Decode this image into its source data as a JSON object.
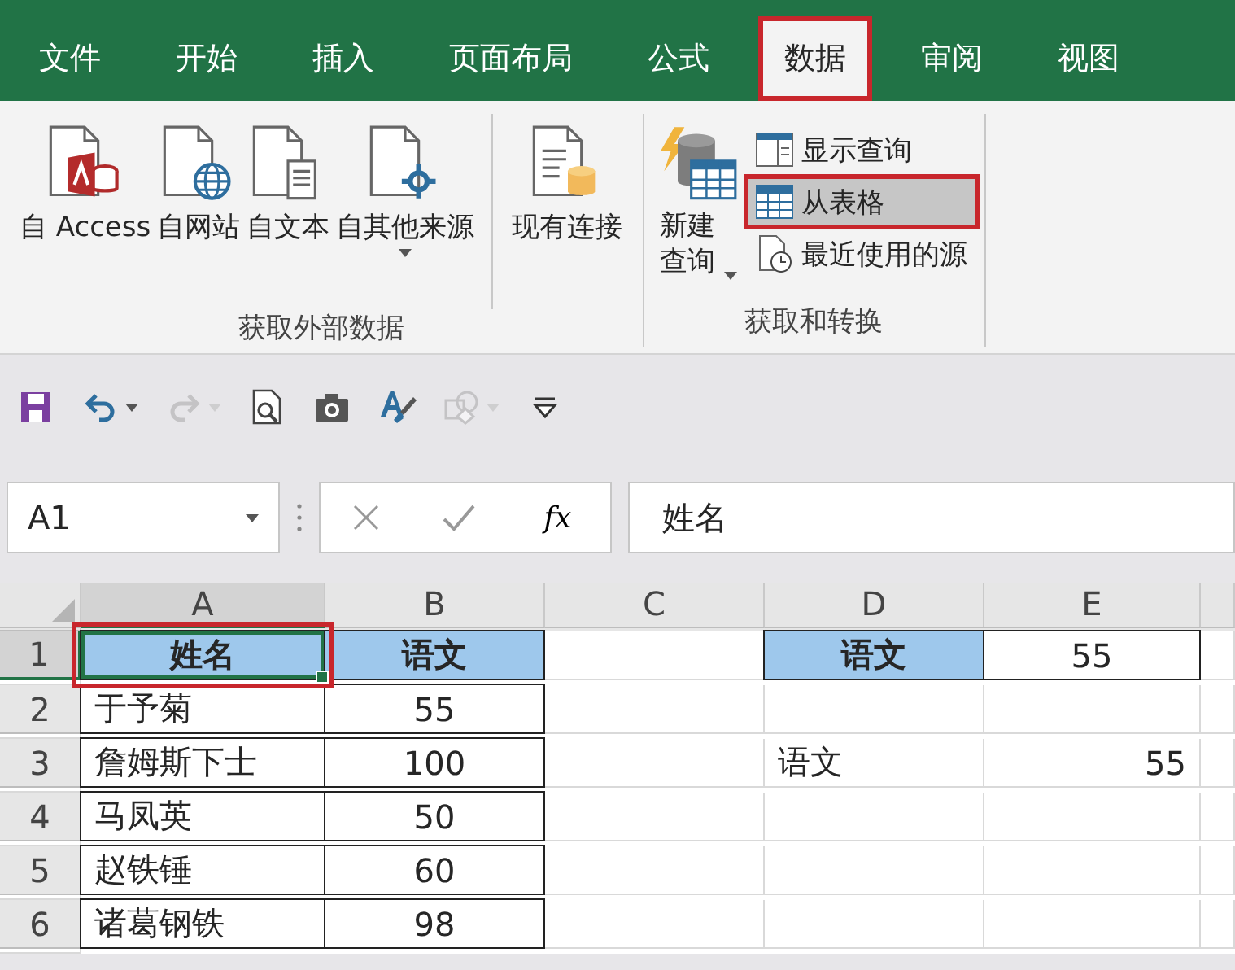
{
  "tabs": [
    {
      "label": "文件",
      "selected": false,
      "highlighted": false
    },
    {
      "label": "开始",
      "selected": false,
      "highlighted": false
    },
    {
      "label": "插入",
      "selected": false,
      "highlighted": false
    },
    {
      "label": "页面布局",
      "selected": false,
      "highlighted": false
    },
    {
      "label": "公式",
      "selected": false,
      "highlighted": false
    },
    {
      "label": "数据",
      "selected": true,
      "highlighted": true
    },
    {
      "label": "审阅",
      "selected": false,
      "highlighted": false
    },
    {
      "label": "视图",
      "selected": false,
      "highlighted": false
    }
  ],
  "ribbon": {
    "groups": [
      {
        "label": "获取外部数据",
        "sections": [
          [
            {
              "kind": "access",
              "label": "自 Access",
              "dropdown": false
            },
            {
              "kind": "web",
              "label": "自网站",
              "dropdown": false
            },
            {
              "kind": "text",
              "label": "自文本",
              "dropdown": false
            },
            {
              "kind": "other",
              "label": "自其他来源",
              "dropdown": true
            }
          ],
          [
            {
              "kind": "connection",
              "label": "现有连接",
              "dropdown": false
            }
          ]
        ]
      },
      {
        "label": "获取和转换",
        "large": [
          {
            "kind": "new-query",
            "label": "新建查询",
            "dropdown": true
          }
        ],
        "small": [
          {
            "kind": "show-query",
            "label": "显示查询",
            "highlighted": false
          },
          {
            "kind": "from-table",
            "label": "从表格",
            "highlighted": true
          },
          {
            "kind": "recent",
            "label": "最近使用的源",
            "highlighted": false
          }
        ]
      }
    ]
  },
  "quick_access": [
    {
      "kind": "save",
      "disabled": false,
      "dropdown": false
    },
    {
      "kind": "undo",
      "disabled": false,
      "dropdown": true
    },
    {
      "kind": "redo",
      "disabled": true,
      "dropdown": true
    },
    {
      "kind": "preview",
      "disabled": false,
      "dropdown": false
    },
    {
      "kind": "camera",
      "disabled": false,
      "dropdown": false
    },
    {
      "kind": "brush",
      "disabled": false,
      "dropdown": false
    },
    {
      "kind": "shapes",
      "disabled": true,
      "dropdown": true
    },
    {
      "kind": "customize",
      "disabled": false,
      "dropdown": false
    }
  ],
  "formula_bar": {
    "name_box": "A1",
    "fx": "fx",
    "value": "姓名"
  },
  "sheet": {
    "columns": [
      "A",
      "B",
      "C",
      "D",
      "E"
    ],
    "rows": [
      {
        "number": "1",
        "cells": [
          {
            "text": "姓名",
            "kind": "header",
            "bordered": true,
            "selected": true,
            "highlighted": true
          },
          {
            "text": "语文",
            "kind": "header",
            "bordered": true,
            "selected": false,
            "highlighted": false
          },
          {
            "bordered": false,
            "selected": false,
            "highlighted": false
          },
          {
            "text": "语文",
            "kind": "header",
            "bordered": true,
            "selected": false,
            "highlighted": false
          },
          {
            "text": "55",
            "kind": "center",
            "bordered": true,
            "selected": false,
            "highlighted": false
          }
        ]
      },
      {
        "number": "2",
        "cells": [
          {
            "text": "于予菊",
            "kind": "left",
            "bordered": true,
            "selected": false,
            "highlighted": false
          },
          {
            "text": "55",
            "kind": "center",
            "bordered": true,
            "selected": false,
            "highlighted": false
          },
          {
            "bordered": false,
            "selected": false,
            "highlighted": false
          },
          {
            "bordered": false,
            "selected": false,
            "highlighted": false
          },
          {
            "bordered": false,
            "selected": false,
            "highlighted": false
          }
        ]
      },
      {
        "number": "3",
        "cells": [
          {
            "text": "詹姆斯下士",
            "kind": "left",
            "bordered": true,
            "selected": false,
            "highlighted": false
          },
          {
            "text": "100",
            "kind": "center",
            "bordered": true,
            "selected": false,
            "highlighted": false
          },
          {
            "bordered": false,
            "selected": false,
            "highlighted": false
          },
          {
            "text": "语文",
            "kind": "left",
            "bordered": false,
            "selected": false,
            "highlighted": false
          },
          {
            "text": "55",
            "kind": "right",
            "bordered": false,
            "selected": false,
            "highlighted": false
          }
        ]
      },
      {
        "number": "4",
        "cells": [
          {
            "text": "马凤英",
            "kind": "left",
            "bordered": true,
            "selected": false,
            "highlighted": false
          },
          {
            "text": "50",
            "kind": "center",
            "bordered": true,
            "selected": false,
            "highlighted": false
          },
          {
            "bordered": false,
            "selected": false,
            "highlighted": false
          },
          {
            "bordered": false,
            "selected": false,
            "highlighted": false
          },
          {
            "bordered": false,
            "selected": false,
            "highlighted": false
          }
        ]
      },
      {
        "number": "5",
        "cells": [
          {
            "text": "赵铁锤",
            "kind": "left",
            "bordered": true,
            "selected": false,
            "highlighted": false
          },
          {
            "text": "60",
            "kind": "center",
            "bordered": true,
            "selected": false,
            "highlighted": false
          },
          {
            "bordered": false,
            "selected": false,
            "highlighted": false
          },
          {
            "bordered": false,
            "selected": false,
            "highlighted": false
          },
          {
            "bordered": false,
            "selected": false,
            "highlighted": false
          }
        ]
      },
      {
        "number": "6",
        "cells": [
          {
            "text": "诸葛钢铁",
            "kind": "left",
            "bordered": true,
            "selected": false,
            "highlighted": false
          },
          {
            "text": "98",
            "kind": "center",
            "bordered": true,
            "selected": false,
            "highlighted": false
          },
          {
            "bordered": false,
            "selected": false,
            "highlighted": false
          },
          {
            "bordered": false,
            "selected": false,
            "highlighted": false
          },
          {
            "bordered": false,
            "selected": false,
            "highlighted": false
          }
        ]
      }
    ]
  }
}
